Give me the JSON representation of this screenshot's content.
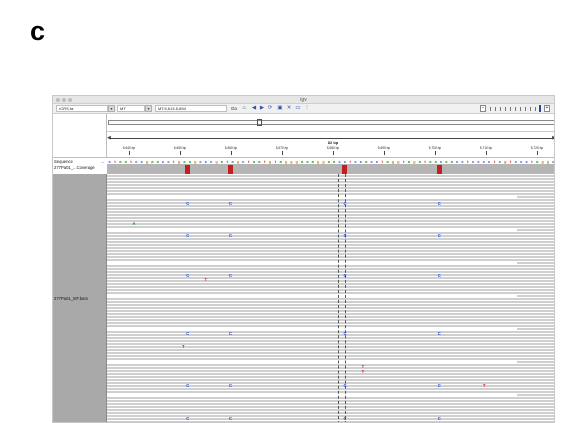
{
  "figure_label": "c",
  "window": {
    "title": "igv"
  },
  "toolbar": {
    "genome": "rCRS.fa",
    "chromosome": "MT",
    "locus": "MT:5,613-5,894",
    "go_label": "Go"
  },
  "toolbar_icons": [
    "home-icon",
    "back-icon",
    "forward-icon",
    "refresh-icon",
    "roi-icon",
    "close-icon",
    "popup-text-icon",
    "divider-icon"
  ],
  "toolbar_glyphs": [
    "⌂",
    "◀",
    "▶",
    "⟳",
    "▣",
    "✕",
    "▭",
    "⋮"
  ],
  "ideogram_marker": "red-box",
  "ruler": {
    "span_label": "82 bp",
    "ticks": [
      "5,640 bp",
      "5,650 bp",
      "5,660 bp",
      "5,670 bp",
      "5,680 bp",
      "5,690 bp",
      "5,700 bp",
      "5,710 bp",
      "5,720 bp"
    ]
  },
  "tracks": {
    "sequence_label": "Sequence",
    "sequence_arrow": "→",
    "coverage_label": "277Pa01_...Coverage",
    "bam_label": "277Pa01_MT.bam"
  },
  "sequence_bases": "ctaatccgaacctgaagcccgatagctaatgtagggaaaggaacctccacctaggtagataacaacctcccctcgtccctaggc",
  "colors": {
    "A": "#1a9c1a",
    "C": "#1e3cd8",
    "G": "#d88a00",
    "T": "#d81e1e",
    "coverage": "#b5b5b5",
    "snp": "#c41e1e"
  },
  "coverage_snp_columns": [
    0.18,
    0.275,
    0.53,
    0.74
  ],
  "read_mismatch_groups": [
    {
      "row_frac": 0.11,
      "bases": "C"
    },
    {
      "row_frac": 0.24,
      "bases": "C"
    },
    {
      "row_frac": 0.4,
      "bases": "C"
    },
    {
      "row_frac": 0.63,
      "bases": "C"
    },
    {
      "row_frac": 0.84,
      "bases": "C"
    },
    {
      "row_frac": 0.97,
      "bases": "C"
    }
  ],
  "extra_mismatches": [
    {
      "col": 0.22,
      "row_frac": 0.415,
      "base": "T"
    },
    {
      "col": 0.17,
      "row_frac": 0.685,
      "base": "T"
    },
    {
      "col": 0.57,
      "row_frac": 0.765,
      "base": "T"
    },
    {
      "col": 0.57,
      "row_frac": 0.785,
      "base": "T"
    },
    {
      "col": 0.84,
      "row_frac": 0.84,
      "base": "T"
    },
    {
      "col": 0.06,
      "row_frac": 0.19,
      "base": "A"
    }
  ]
}
